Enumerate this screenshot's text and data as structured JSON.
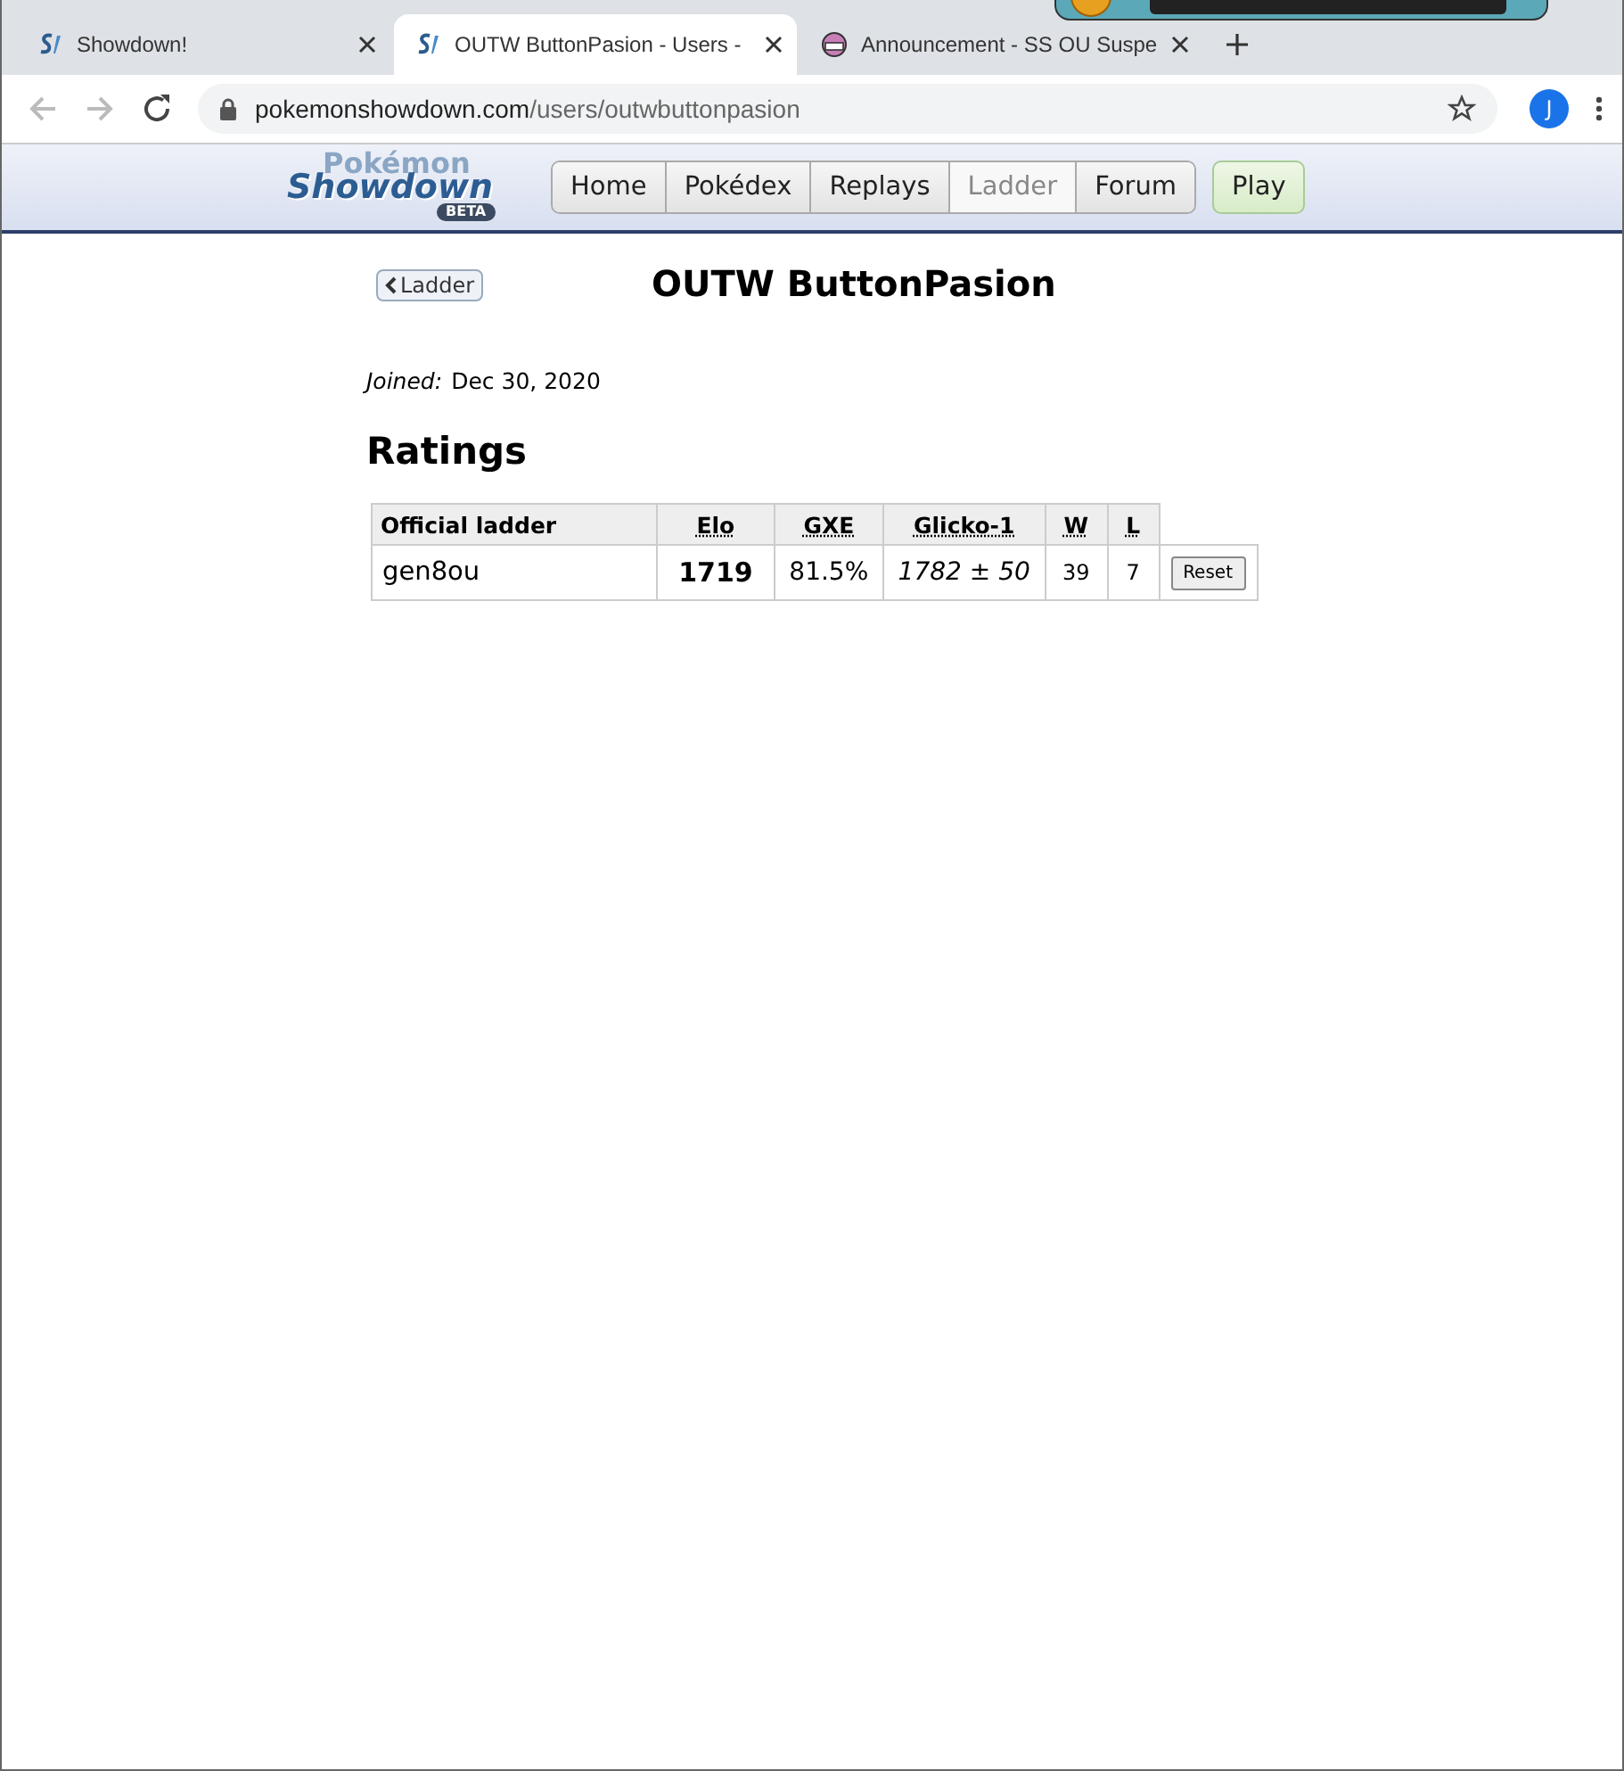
{
  "browser": {
    "tabs": [
      {
        "title": "Showdown!",
        "selected": false
      },
      {
        "title": "OUTW ButtonPasion - Users -",
        "selected": true
      },
      {
        "title": "Announcement - SS OU Suspe",
        "selected": false
      }
    ],
    "address": {
      "host": "pokemonshowdown.com",
      "path": "/users/outwbuttonpasion"
    },
    "profile_initial": "J"
  },
  "header": {
    "logo": {
      "line_1": "Pokémon",
      "line_2": "Showdown",
      "badge": "BETA"
    },
    "nav": [
      {
        "label": "Home",
        "selected": false
      },
      {
        "label": "Pokédex",
        "selected": false
      },
      {
        "label": "Replays",
        "selected": false
      },
      {
        "label": "Ladder",
        "selected": true
      },
      {
        "label": "Forum",
        "selected": false
      }
    ],
    "play_button": "Play"
  },
  "page": {
    "back_button": "Ladder",
    "title": "OUTW ButtonPasion",
    "joined_label": "Joined:",
    "joined_date": "Dec 30, 2020",
    "section_title": "Ratings",
    "table": {
      "columns": [
        "Official ladder",
        "Elo",
        "GXE",
        "Glicko-1",
        "W",
        "L"
      ],
      "rows": [
        {
          "format": "gen8ou",
          "elo": "1719",
          "gxe": "81.5%",
          "glicko": "*1782* ± *50*",
          "w": "39",
          "l": "7",
          "action": "Reset"
        }
      ]
    }
  }
}
